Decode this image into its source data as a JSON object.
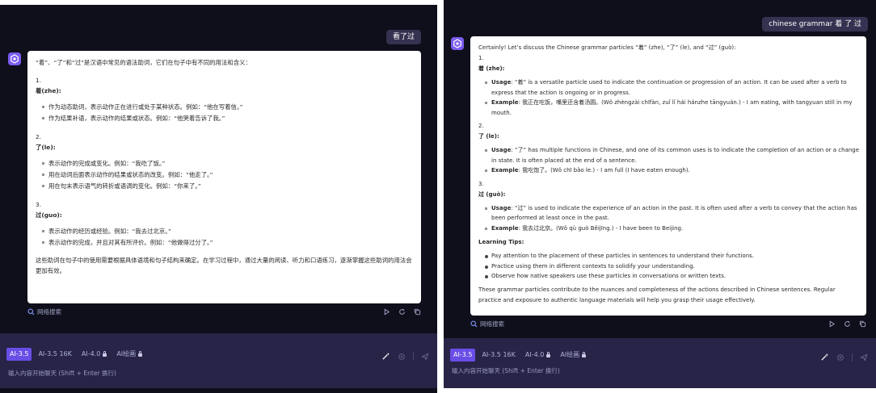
{
  "colors": {
    "panel_bg": "#0f0f1c",
    "input_bg": "#272447",
    "accent": "#6a4de6",
    "bubble": "#353150"
  },
  "icons": [
    "assistant-avatar-icon",
    "search-icon",
    "play-icon",
    "refresh-icon",
    "copy-icon",
    "magic-pen-icon",
    "attach-icon",
    "send-icon",
    "lock-icon"
  ],
  "left": {
    "user_message": "看了过",
    "answer": {
      "intro": "“着”、“了”和“过”是汉语中常见的语法助词，它们在句子中有不同的用法和含义：",
      "sections": [
        {
          "num": "1.",
          "title": "着(zhe)",
          "colon": ":",
          "bullets": [
            "作为动态助词，表示动作正在进行或处于某种状态。例如：“他在写着信。”",
            "作为结果补语，表示动作的结果或状态。例如：“他哭着告诉了我。”"
          ]
        },
        {
          "num": "2.",
          "title": "了(le)",
          "colon": ":",
          "bullets": [
            "表示动作的完成或变化。例如：“我吃了饭。”",
            "用在动词后面表示动作的结果或状态的改变。例如：“他走了。”",
            "用在句末表示语气的转折或语调的变化。例如：“你来了。”"
          ]
        },
        {
          "num": "3.",
          "title": "过(guo)",
          "colon": ":",
          "bullets": [
            "表示动作的经历或经验。例如：“我去过北京。”",
            "表示动作的完成，并且对其有所评价。例如：“他做得过分了。”"
          ]
        }
      ],
      "conclusion": "这些助词在句子中的使用需要根据具体语境和句子结构来确定。在学习过程中，通过大量的阅读、听力和口语练习，逐渐掌握这些助词的用法会更加有效。"
    },
    "web_search": "网络搜索",
    "models": [
      {
        "label": "AI-3.5",
        "active": true
      },
      {
        "label": "AI-3.5 16K"
      },
      {
        "label": "AI-4.0",
        "locked": true
      },
      {
        "label": "AI绘画",
        "locked": true
      }
    ],
    "placeholder": "输入内容开始聊天 (Shift + Enter 换行)"
  },
  "right": {
    "user_message": "chinese grammar 着 了 过",
    "answer": {
      "intro": "Certainly! Let’s discuss the Chinese grammar particles “着” (zhe), “了” (le), and “过” (guò):",
      "sections": [
        {
          "num": "1.",
          "title": "着 (zhe)",
          "colon": ":",
          "bullets": [
            {
              "label": "Usage",
              "text": ": “着” is a versatile particle used to indicate the continuation or progression of an action. It can be used after a verb to express that the action is ongoing or in progress."
            },
            {
              "label": "Example",
              "text": ": 我正在吃饭，嘴里还含着汤圆。(Wǒ zhèngzài chīfàn, zuǐ lǐ hái hánzhe tāngyuán.) - I am eating, with tangyuan still in my mouth."
            }
          ]
        },
        {
          "num": "2.",
          "title": "了 (le)",
          "colon": ":",
          "bullets": [
            {
              "label": "Usage",
              "text": ": “了” has multiple functions in Chinese, and one of its common uses is to indicate the completion of an action or a change in state. It is often placed at the end of a sentence."
            },
            {
              "label": "Example",
              "text": ": 我吃饱了。(Wǒ chī bǎo le.) - I am full (I have eaten enough)."
            }
          ]
        },
        {
          "num": "3.",
          "title": "过 (guò)",
          "colon": ":",
          "bullets": [
            {
              "label": "Usage",
              "text": ": “过” is used to indicate the experience of an action in the past. It is often used after a verb to convey that the action has been performed at least once in the past."
            },
            {
              "label": "Example",
              "text": ": 我去过北京。(Wǒ qù guò Běijīng.) - I have been to Beijing."
            }
          ]
        }
      ],
      "tips_title": "Learning Tips",
      "tips": [
        "Pay attention to the placement of these particles in sentences to understand their functions.",
        "Practice using them in different contexts to solidify your understanding.",
        "Observe how native speakers use these particles in conversations or written texts."
      ],
      "conclusion": "These grammar particles contribute to the nuances and completeness of the actions described in Chinese sentences. Regular practice and exposure to authentic language materials will help you grasp their usage effectively."
    },
    "web_search": "网络搜索",
    "models": [
      {
        "label": "AI-3.5",
        "active": true
      },
      {
        "label": "AI-3.5 16K"
      },
      {
        "label": "AI-4.0",
        "locked": true
      },
      {
        "label": "AI绘画",
        "locked": true
      }
    ],
    "placeholder": "输入内容开始聊天 (Shift + Enter 换行)"
  }
}
